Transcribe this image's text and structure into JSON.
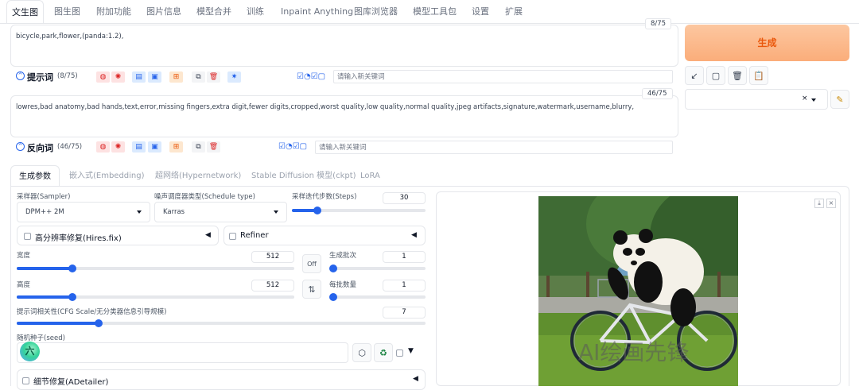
{
  "top_tabs": [
    "文生图",
    "图生图",
    "附加功能",
    "图片信息",
    "模型合并",
    "训练",
    "Inpaint Anything",
    "图库浏览器",
    "模型工具包",
    "设置",
    "扩展"
  ],
  "prompt": {
    "text": "bicycle,park,flower,(panda:1.2),",
    "counter": "8/75",
    "label": "提示词",
    "count": "(8/75)",
    "keyword_placeholder": "请输入新关键词"
  },
  "negative": {
    "text": "lowres,bad anatomy,bad hands,text,error,missing fingers,extra digit,fewer digits,cropped,worst quality,low quality,normal quality,jpeg artifacts,signature,watermark,username,blurry,",
    "counter": "46/75",
    "label": "反向词",
    "count": "(46/75)",
    "keyword_placeholder": "请输入新关键词"
  },
  "generate_label": "生成",
  "sub_tabs": [
    "生成参数",
    "嵌入式(Embedding)",
    "超网络(Hypernetwork)",
    "Stable Diffusion 模型(ckpt)",
    "LoRA"
  ],
  "params": {
    "sampler_label": "采样器(Sampler)",
    "sampler_value": "DPM++ 2M",
    "schedule_label": "噪声调度器类型(Schedule type)",
    "schedule_value": "Karras",
    "steps_label": "采样迭代步数(Steps)",
    "steps_value": "30",
    "steps_fraction": 0.19,
    "hires_label": "高分辨率修复(Hires.fix)",
    "refiner_label": "Refiner",
    "width_label": "宽度",
    "width_value": "512",
    "width_fraction": 0.2,
    "height_label": "高度",
    "height_value": "512",
    "height_fraction": 0.2,
    "swap_off_label": "Off",
    "batch_count_label": "生成批次",
    "batch_count_value": "1",
    "batch_size_label": "每批数量",
    "batch_size_value": "1",
    "cfg_label": "提示词相关性(CFG Scale/无分类器信息引导规模)",
    "cfg_value": "7",
    "cfg_fraction": 0.2,
    "seed_label": "随机种子(seed)",
    "seed_badge": "六",
    "adetailer_label": "细节修复(ADetailer)"
  },
  "watermark": "AI绘画先锋",
  "colors": {
    "accent": "#2563eb",
    "generate_bg": "#fbb98a",
    "generate_text": "#ea580c"
  }
}
